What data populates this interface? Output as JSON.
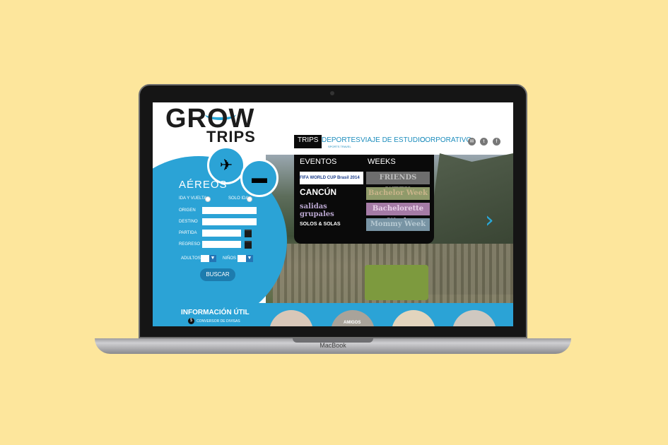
{
  "device": {
    "base_label": "MacBook"
  },
  "logo": {
    "line1": "GROW",
    "line2": "TRIPS"
  },
  "nav": {
    "trips": "TRIPS",
    "deportes": "DEPORTES",
    "deportes_sub": "SPORTS TRAVEL",
    "viaje": "VIAJE DE ESTUDIO",
    "corporativo": "CORPORATIVO"
  },
  "mega_menu": {
    "eventos_title": "EVENTOS",
    "weeks_title": "WEEKS",
    "eventos": [
      "FIFA WORLD CUP Brasil 2014",
      "CANCÚN",
      "salidas grupales",
      "SOLOS & SOLAS"
    ],
    "weeks": [
      "FRIENDS WEEK",
      "Bachelor Week",
      "Bachelorette Week",
      "Mommy Week"
    ]
  },
  "search": {
    "title": "AÉREOS",
    "ida_vuelta": "IDA Y VUELTA",
    "solo_ida": "SOLO IDA",
    "origen": "ORIGEN",
    "destino": "DESTINO",
    "partida": "PARTIDA",
    "regreso": "REGRESO",
    "adultos": "ADULTOS",
    "ninos": "NIÑOS",
    "buscar": "BUSCAR"
  },
  "info": {
    "title": "INFORMACIÓN ÚTIL",
    "conversor": "CONVERSOR DE DIVISAS",
    "amigos": "AMIGOS"
  },
  "colors": {
    "background": "#fde69c",
    "accent": "#2ba3d6",
    "dark": "#0a0a0a"
  }
}
